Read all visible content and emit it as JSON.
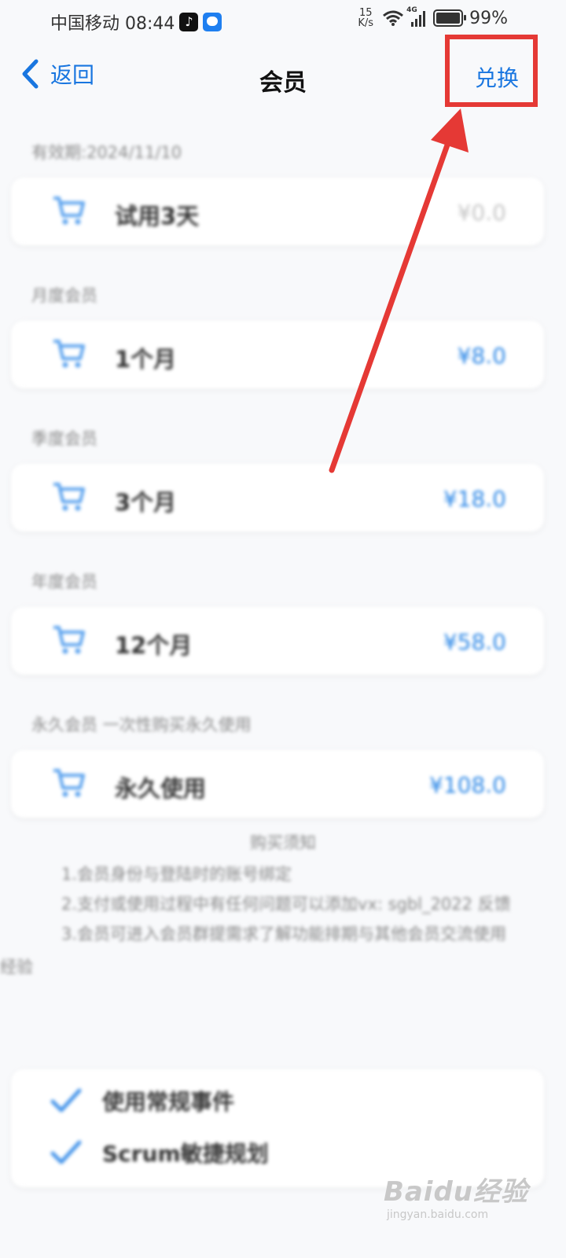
{
  "status_bar": {
    "carrier_time": "中国移动 08:44",
    "speed_value": "15",
    "speed_unit": "K/s",
    "network": "4G",
    "battery": "99%"
  },
  "header": {
    "back_label": "返回",
    "title": "会员",
    "redeem_label": "兑换"
  },
  "sections": [
    {
      "label": "有效期:2024/11/10",
      "plan": "试用3天",
      "price": "¥0.0"
    },
    {
      "label": "月度会员",
      "plan": "1个月",
      "price": "¥8.0"
    },
    {
      "label": "季度会员",
      "plan": "3个月",
      "price": "¥18.0"
    },
    {
      "label": "年度会员",
      "plan": "12个月",
      "price": "¥58.0"
    },
    {
      "label": "永久会员 一次性购买永久使用",
      "plan": "永久使用",
      "price": "¥108.0"
    }
  ],
  "notice": {
    "title": "购买须知",
    "lines": [
      "1.会员身份与登陆时的账号绑定",
      "2.支付或使用过程中有任何问题可以添加vx: sgbl_2022 反馈",
      "3.会员可进入会员群提需求了解功能排期与其他会员交流使用"
    ],
    "wrap": "经验"
  },
  "features": [
    "使用常规事件",
    "Scrum敏捷规划"
  ],
  "watermark": {
    "brand": "Baidu经验",
    "url": "jingyan.baidu.com"
  },
  "colors": {
    "accent": "#1976e0",
    "price": "#2a86e6",
    "annotation": "#e53935"
  }
}
